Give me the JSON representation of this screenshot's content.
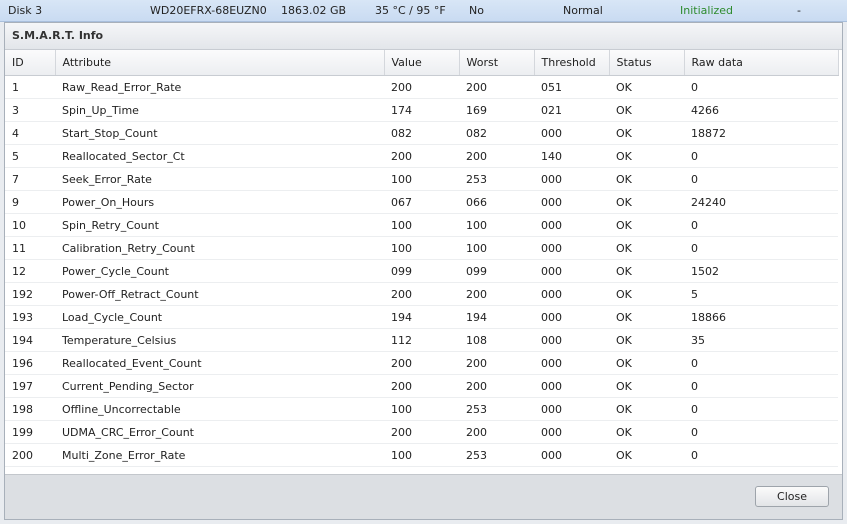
{
  "disk_row": {
    "name": "Disk 3",
    "model": "WD20EFRX-68EUZN0",
    "capacity": "1863.02 GB",
    "temperature": "35 °C / 95 °F",
    "flag": "No",
    "health": "Normal",
    "status": "Initialized",
    "extra": "-",
    "status_color": "#2e8b2e"
  },
  "dialog": {
    "title": "S.M.A.R.T. Info",
    "close_label": "Close"
  },
  "columns": [
    "ID",
    "Attribute",
    "Value",
    "Worst",
    "Threshold",
    "Status",
    "Raw data"
  ],
  "rows": [
    [
      "1",
      "Raw_Read_Error_Rate",
      "200",
      "200",
      "051",
      "OK",
      "0"
    ],
    [
      "3",
      "Spin_Up_Time",
      "174",
      "169",
      "021",
      "OK",
      "4266"
    ],
    [
      "4",
      "Start_Stop_Count",
      "082",
      "082",
      "000",
      "OK",
      "18872"
    ],
    [
      "5",
      "Reallocated_Sector_Ct",
      "200",
      "200",
      "140",
      "OK",
      "0"
    ],
    [
      "7",
      "Seek_Error_Rate",
      "100",
      "253",
      "000",
      "OK",
      "0"
    ],
    [
      "9",
      "Power_On_Hours",
      "067",
      "066",
      "000",
      "OK",
      "24240"
    ],
    [
      "10",
      "Spin_Retry_Count",
      "100",
      "100",
      "000",
      "OK",
      "0"
    ],
    [
      "11",
      "Calibration_Retry_Count",
      "100",
      "100",
      "000",
      "OK",
      "0"
    ],
    [
      "12",
      "Power_Cycle_Count",
      "099",
      "099",
      "000",
      "OK",
      "1502"
    ],
    [
      "192",
      "Power-Off_Retract_Count",
      "200",
      "200",
      "000",
      "OK",
      "5"
    ],
    [
      "193",
      "Load_Cycle_Count",
      "194",
      "194",
      "000",
      "OK",
      "18866"
    ],
    [
      "194",
      "Temperature_Celsius",
      "112",
      "108",
      "000",
      "OK",
      "35"
    ],
    [
      "196",
      "Reallocated_Event_Count",
      "200",
      "200",
      "000",
      "OK",
      "0"
    ],
    [
      "197",
      "Current_Pending_Sector",
      "200",
      "200",
      "000",
      "OK",
      "0"
    ],
    [
      "198",
      "Offline_Uncorrectable",
      "100",
      "253",
      "000",
      "OK",
      "0"
    ],
    [
      "199",
      "UDMA_CRC_Error_Count",
      "200",
      "200",
      "000",
      "OK",
      "0"
    ],
    [
      "200",
      "Multi_Zone_Error_Rate",
      "100",
      "253",
      "000",
      "OK",
      "0"
    ]
  ]
}
